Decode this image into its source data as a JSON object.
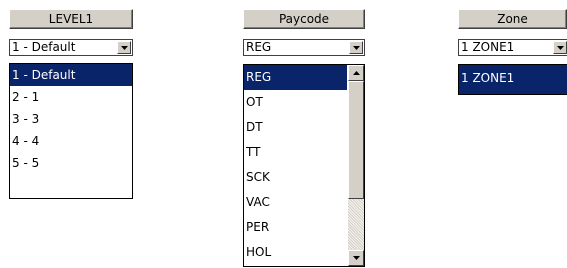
{
  "level1": {
    "header": "LEVEL1",
    "selected": "1 - Default",
    "options": [
      "1 - Default",
      "2 - 1",
      "3 - 3",
      "4 - 4",
      "5 - 5"
    ],
    "selected_index": 0
  },
  "paycode": {
    "header": "Paycode",
    "selected": "REG",
    "options": [
      "REG",
      "OT",
      "DT",
      "TT",
      "SCK",
      "VAC",
      "PER",
      "HOL"
    ],
    "selected_index": 0
  },
  "zone": {
    "header": "Zone",
    "selected": "1 ZONE1",
    "options": [
      "1 ZONE1"
    ],
    "selected_index": 0
  }
}
